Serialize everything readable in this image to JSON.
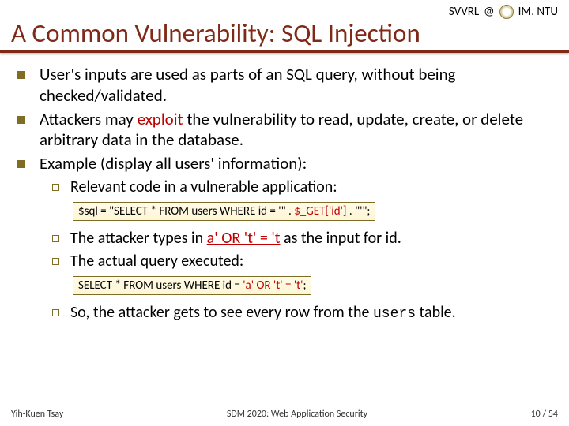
{
  "header": {
    "lab": "SVVRL",
    "at": "@",
    "org": "IM. NTU"
  },
  "title": "A Common Vulnerability: SQL Injection",
  "bullets": [
    "User's inputs are used as parts of an SQL query, without being checked/validated.",
    "Attackers may ",
    " the vulnerability to read, update, create, or delete arbitrary data in the database.",
    "Example (display all users' information):"
  ],
  "exploit": "exploit",
  "sub": {
    "s1": "Relevant code in a vulnerable application:",
    "code1_a": "$sql = \"SELECT * FROM users WHERE id = '\" . ",
    "code1_b": "$_GET['id']",
    "code1_c": ". \"'\";",
    "s2_a": "The attacker types in ",
    "s2_b": "a' OR 't' = 't",
    "s2_c": " as the input for id.",
    "s3": "The actual query executed:",
    "code2_a": "SELECT * FROM users WHERE id = ",
    "code2_b": "'a' OR 't' = 't'",
    "code2_c": ";",
    "s4_a": "So, the attacker gets to see every row from the ",
    "s4_b": "users",
    "s4_c": " table."
  },
  "footer": {
    "author": "Yih-Kuen Tsay",
    "course": "SDM 2020: Web Application Security",
    "page": "10 / 54"
  }
}
